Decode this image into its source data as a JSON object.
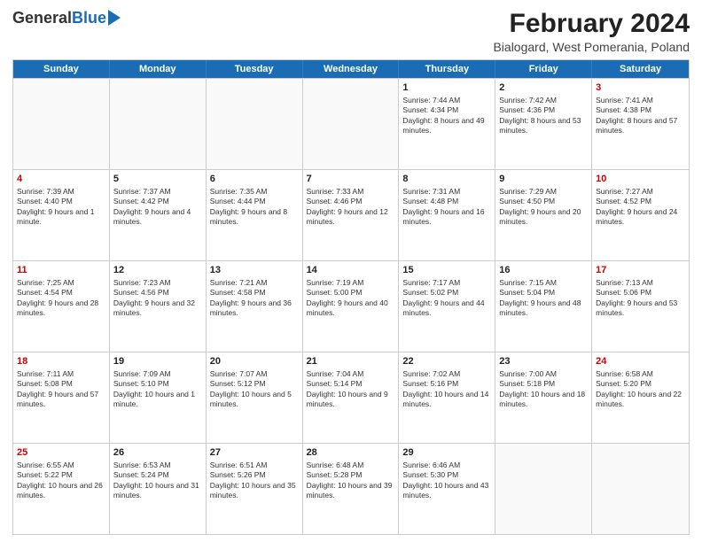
{
  "header": {
    "logo_general": "General",
    "logo_blue": "Blue",
    "title": "February 2024",
    "subtitle": "Bialogard, West Pomerania, Poland"
  },
  "days": [
    "Sunday",
    "Monday",
    "Tuesday",
    "Wednesday",
    "Thursday",
    "Friday",
    "Saturday"
  ],
  "weeks": [
    [
      {
        "day": "",
        "empty": true
      },
      {
        "day": "",
        "empty": true
      },
      {
        "day": "",
        "empty": true
      },
      {
        "day": "",
        "empty": true
      },
      {
        "day": "1",
        "sunrise": "7:44 AM",
        "sunset": "4:34 PM",
        "daylight": "8 hours and 49 minutes."
      },
      {
        "day": "2",
        "sunrise": "7:42 AM",
        "sunset": "4:36 PM",
        "daylight": "8 hours and 53 minutes."
      },
      {
        "day": "3",
        "sunrise": "7:41 AM",
        "sunset": "4:38 PM",
        "daylight": "8 hours and 57 minutes."
      }
    ],
    [
      {
        "day": "4",
        "sunrise": "7:39 AM",
        "sunset": "4:40 PM",
        "daylight": "9 hours and 1 minute."
      },
      {
        "day": "5",
        "sunrise": "7:37 AM",
        "sunset": "4:42 PM",
        "daylight": "9 hours and 4 minutes."
      },
      {
        "day": "6",
        "sunrise": "7:35 AM",
        "sunset": "4:44 PM",
        "daylight": "9 hours and 8 minutes."
      },
      {
        "day": "7",
        "sunrise": "7:33 AM",
        "sunset": "4:46 PM",
        "daylight": "9 hours and 12 minutes."
      },
      {
        "day": "8",
        "sunrise": "7:31 AM",
        "sunset": "4:48 PM",
        "daylight": "9 hours and 16 minutes."
      },
      {
        "day": "9",
        "sunrise": "7:29 AM",
        "sunset": "4:50 PM",
        "daylight": "9 hours and 20 minutes."
      },
      {
        "day": "10",
        "sunrise": "7:27 AM",
        "sunset": "4:52 PM",
        "daylight": "9 hours and 24 minutes."
      }
    ],
    [
      {
        "day": "11",
        "sunrise": "7:25 AM",
        "sunset": "4:54 PM",
        "daylight": "9 hours and 28 minutes."
      },
      {
        "day": "12",
        "sunrise": "7:23 AM",
        "sunset": "4:56 PM",
        "daylight": "9 hours and 32 minutes."
      },
      {
        "day": "13",
        "sunrise": "7:21 AM",
        "sunset": "4:58 PM",
        "daylight": "9 hours and 36 minutes."
      },
      {
        "day": "14",
        "sunrise": "7:19 AM",
        "sunset": "5:00 PM",
        "daylight": "9 hours and 40 minutes."
      },
      {
        "day": "15",
        "sunrise": "7:17 AM",
        "sunset": "5:02 PM",
        "daylight": "9 hours and 44 minutes."
      },
      {
        "day": "16",
        "sunrise": "7:15 AM",
        "sunset": "5:04 PM",
        "daylight": "9 hours and 48 minutes."
      },
      {
        "day": "17",
        "sunrise": "7:13 AM",
        "sunset": "5:06 PM",
        "daylight": "9 hours and 53 minutes."
      }
    ],
    [
      {
        "day": "18",
        "sunrise": "7:11 AM",
        "sunset": "5:08 PM",
        "daylight": "9 hours and 57 minutes."
      },
      {
        "day": "19",
        "sunrise": "7:09 AM",
        "sunset": "5:10 PM",
        "daylight": "10 hours and 1 minute."
      },
      {
        "day": "20",
        "sunrise": "7:07 AM",
        "sunset": "5:12 PM",
        "daylight": "10 hours and 5 minutes."
      },
      {
        "day": "21",
        "sunrise": "7:04 AM",
        "sunset": "5:14 PM",
        "daylight": "10 hours and 9 minutes."
      },
      {
        "day": "22",
        "sunrise": "7:02 AM",
        "sunset": "5:16 PM",
        "daylight": "10 hours and 14 minutes."
      },
      {
        "day": "23",
        "sunrise": "7:00 AM",
        "sunset": "5:18 PM",
        "daylight": "10 hours and 18 minutes."
      },
      {
        "day": "24",
        "sunrise": "6:58 AM",
        "sunset": "5:20 PM",
        "daylight": "10 hours and 22 minutes."
      }
    ],
    [
      {
        "day": "25",
        "sunrise": "6:55 AM",
        "sunset": "5:22 PM",
        "daylight": "10 hours and 26 minutes."
      },
      {
        "day": "26",
        "sunrise": "6:53 AM",
        "sunset": "5:24 PM",
        "daylight": "10 hours and 31 minutes."
      },
      {
        "day": "27",
        "sunrise": "6:51 AM",
        "sunset": "5:26 PM",
        "daylight": "10 hours and 35 minutes."
      },
      {
        "day": "28",
        "sunrise": "6:48 AM",
        "sunset": "5:28 PM",
        "daylight": "10 hours and 39 minutes."
      },
      {
        "day": "29",
        "sunrise": "6:46 AM",
        "sunset": "5:30 PM",
        "daylight": "10 hours and 43 minutes."
      },
      {
        "day": "",
        "empty": true
      },
      {
        "day": "",
        "empty": true
      }
    ]
  ]
}
